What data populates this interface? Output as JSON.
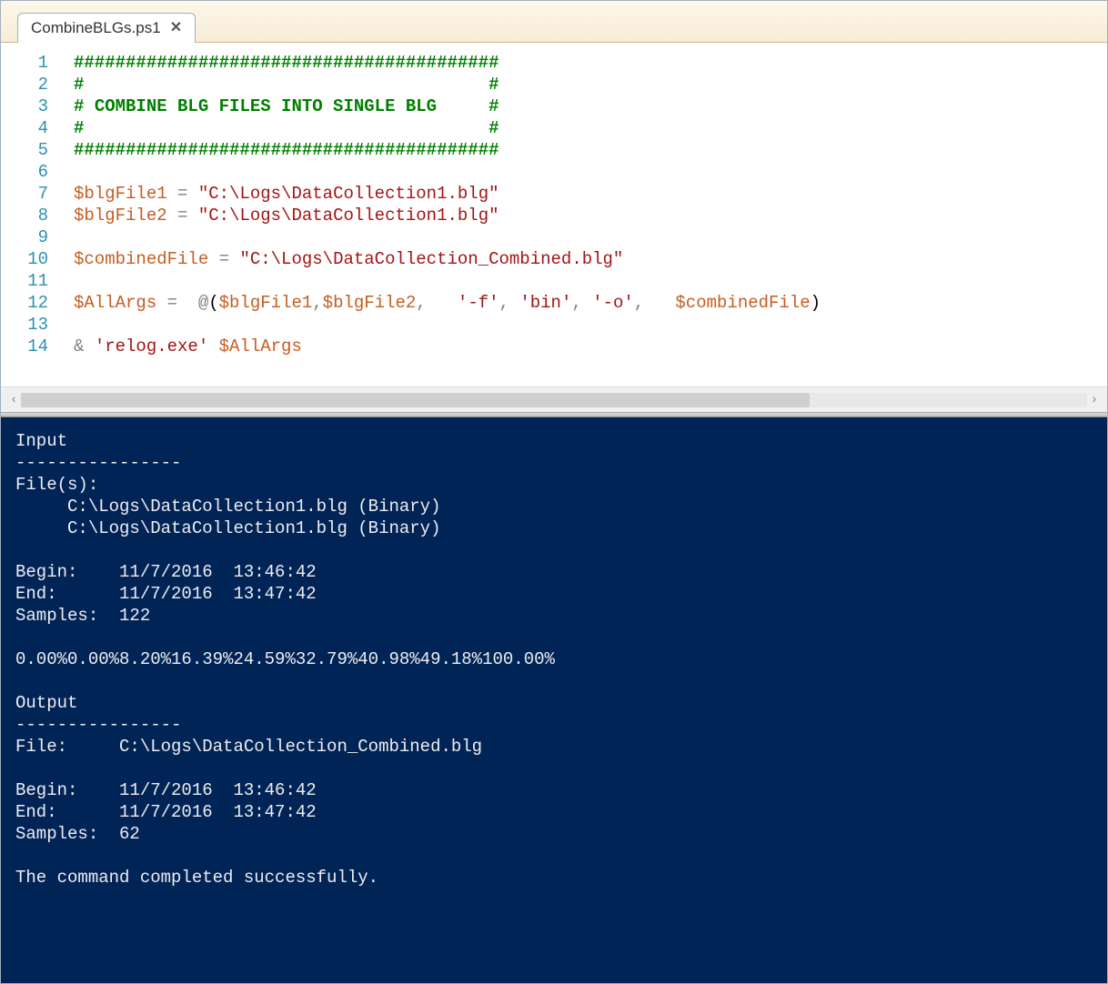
{
  "tab": {
    "label": "CombineBLGs.ps1"
  },
  "lineNumbers": [
    "1",
    "2",
    "3",
    "4",
    "5",
    "6",
    "7",
    "8",
    "9",
    "10",
    "11",
    "12",
    "13",
    "14"
  ],
  "code": {
    "l1": "#########################################",
    "l2": "#                                       #",
    "l3_a": "# ",
    "l3_b": "COMBINE BLG FILES INTO SINGLE BLG",
    "l3_c": "     #",
    "l4": "#                                       #",
    "l5": "#########################################",
    "var_blg1": "$blgFile1",
    "eq": " = ",
    "str_blg1": "\"C:\\Logs\\DataCollection1.blg\"",
    "var_blg2": "$blgFile2",
    "str_blg2": "\"C:\\Logs\\DataCollection1.blg\"",
    "var_combined": "$combinedFile",
    "str_combined": "\"C:\\Logs\\DataCollection_Combined.blg\"",
    "var_allargs": "$AllArgs",
    "eq2": " =  ",
    "at": "@",
    "open_p": "(",
    "comma1": ",",
    "comma2": ", ",
    "pad1": "  ",
    "str_f": "'-f'",
    "str_bin": "'bin'",
    "str_o": "'-o'",
    "pad2": "  ",
    "close_p": ")",
    "amp": "&",
    "space": " ",
    "str_relog": "'relog.exe'"
  },
  "console": {
    "text": "Input\n----------------\nFile(s):\n     C:\\Logs\\DataCollection1.blg (Binary)\n     C:\\Logs\\DataCollection1.blg (Binary)\n\nBegin:    11/7/2016  13:46:42\nEnd:      11/7/2016  13:47:42\nSamples:  122\n\n0.00%0.00%8.20%16.39%24.59%32.79%40.98%49.18%100.00%\n\nOutput\n----------------\nFile:     C:\\Logs\\DataCollection_Combined.blg\n\nBegin:    11/7/2016  13:46:42\nEnd:      11/7/2016  13:47:42\nSamples:  62\n\nThe command completed successfully."
  }
}
